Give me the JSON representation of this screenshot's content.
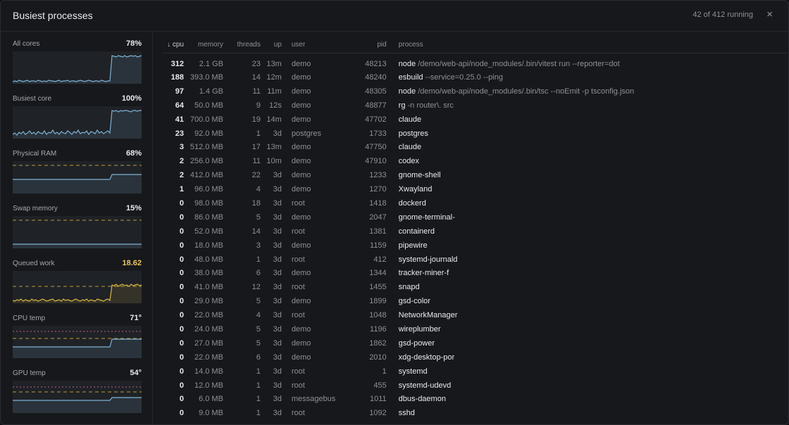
{
  "header": {
    "title": "Busiest processes",
    "count": "42 of 412 running",
    "close": "×"
  },
  "metrics": [
    {
      "label": "All cores",
      "value": "78%",
      "warn": false,
      "color": "#7fb2d6",
      "series": [
        3,
        4,
        3,
        5,
        4,
        3,
        4,
        5,
        3,
        4,
        4,
        3,
        5,
        4,
        3,
        4,
        3,
        5,
        4,
        4,
        3,
        4,
        5,
        3,
        4,
        4,
        5,
        3,
        4,
        4,
        3,
        4,
        5,
        4,
        3,
        4,
        5,
        4,
        3,
        4,
        4,
        3,
        5,
        4,
        3,
        4,
        4,
        40,
        39,
        38,
        40,
        39,
        38,
        40,
        38,
        39,
        40,
        39,
        40,
        38,
        39,
        40
      ]
    },
    {
      "label": "Busiest core",
      "value": "100%",
      "warn": false,
      "color": "#7fb2d6",
      "series": [
        6,
        8,
        5,
        9,
        7,
        10,
        6,
        8,
        11,
        7,
        9,
        6,
        10,
        8,
        7,
        11,
        6,
        9,
        8,
        12,
        7,
        9,
        6,
        10,
        8,
        7,
        11,
        9,
        6,
        10,
        8,
        12,
        7,
        9,
        8,
        11,
        6,
        10,
        9,
        7,
        12,
        8,
        10,
        7,
        9,
        11,
        8,
        40,
        39,
        40,
        38,
        40,
        39,
        40,
        40,
        39,
        38,
        40,
        40,
        39,
        40,
        40
      ]
    },
    {
      "label": "Physical RAM",
      "value": "68%",
      "warn": false,
      "color": "#7fb2d6",
      "series": [
        20,
        20,
        20,
        20,
        20,
        20,
        20,
        20,
        20,
        20,
        20,
        20,
        20,
        20,
        20,
        20,
        20,
        20,
        20,
        20,
        20,
        20,
        20,
        20,
        20,
        20,
        20,
        20,
        20,
        20,
        20,
        20,
        20,
        20,
        20,
        20,
        20,
        20,
        20,
        20,
        20,
        20,
        20,
        20,
        20,
        20,
        20,
        27,
        27,
        27,
        27,
        27,
        27,
        27,
        27,
        27,
        27,
        27,
        27,
        27,
        27,
        27
      ],
      "threshold": 40
    },
    {
      "label": "Swap memory",
      "value": "15%",
      "warn": false,
      "color": "#7fb2d6",
      "series": [
        6,
        6,
        6,
        6,
        6,
        6,
        6,
        6,
        6,
        6,
        6,
        6,
        6,
        6,
        6,
        6,
        6,
        6,
        6,
        6,
        6,
        6,
        6,
        6,
        6,
        6,
        6,
        6,
        6,
        6,
        6,
        6,
        6,
        6,
        6,
        6,
        6,
        6,
        6,
        6,
        6,
        6,
        6,
        6,
        6,
        6,
        6,
        6,
        6,
        6,
        6,
        6,
        6,
        6,
        6,
        6,
        6,
        6,
        6,
        6,
        6,
        6
      ],
      "threshold": 40
    },
    {
      "label": "Queued work",
      "value": "18.62",
      "warn": true,
      "color": "#d9b941",
      "series": [
        4,
        3,
        5,
        4,
        6,
        3,
        5,
        4,
        3,
        6,
        4,
        5,
        3,
        4,
        6,
        5,
        3,
        4,
        5,
        6,
        3,
        4,
        5,
        3,
        6,
        4,
        5,
        4,
        3,
        5,
        6,
        4,
        3,
        5,
        4,
        6,
        3,
        5,
        4,
        3,
        6,
        5,
        4,
        3,
        5,
        6,
        4,
        26,
        25,
        27,
        24,
        26,
        27,
        25,
        26,
        24,
        27,
        25,
        26,
        27,
        25,
        26
      ],
      "threshold": 24
    },
    {
      "label": "CPU temp",
      "value": "71°",
      "warn": false,
      "color": "#7fb2d6",
      "series": [
        16,
        16,
        16,
        16,
        16,
        16,
        16,
        16,
        16,
        16,
        16,
        16,
        16,
        16,
        16,
        16,
        16,
        16,
        16,
        16,
        16,
        16,
        16,
        16,
        16,
        16,
        16,
        16,
        16,
        16,
        16,
        16,
        16,
        16,
        16,
        16,
        16,
        16,
        16,
        16,
        16,
        16,
        16,
        16,
        16,
        16,
        16,
        27,
        27,
        27,
        27,
        27,
        27,
        27,
        27,
        27,
        27,
        27,
        27,
        27,
        27,
        27
      ],
      "threshold": 28,
      "threshold2": 38
    },
    {
      "label": "GPU temp",
      "value": "54°",
      "warn": false,
      "color": "#7fb2d6",
      "series": [
        18,
        18,
        18,
        18,
        18,
        18,
        18,
        18,
        18,
        18,
        18,
        18,
        18,
        18,
        18,
        18,
        18,
        18,
        18,
        18,
        18,
        18,
        18,
        18,
        18,
        18,
        18,
        18,
        18,
        18,
        18,
        18,
        18,
        18,
        18,
        18,
        18,
        18,
        18,
        18,
        18,
        18,
        18,
        18,
        18,
        18,
        18,
        22,
        22,
        22,
        22,
        22,
        22,
        22,
        22,
        22,
        22,
        22,
        22,
        22,
        22,
        22
      ],
      "threshold": 30,
      "threshold2": 37
    }
  ],
  "table": {
    "columns": {
      "cpu": "↓ cpu",
      "memory": "memory",
      "threads": "threads",
      "up": "up",
      "user": "user",
      "pid": "pid",
      "process": "process"
    },
    "rows": [
      {
        "cpu": "312",
        "memory": "2.1 GB",
        "threads": "23",
        "up": "13m",
        "user": "demo",
        "pid": "48213",
        "name": "node",
        "args": " /demo/web-api/node_modules/.bin/vitest run --reporter=dot"
      },
      {
        "cpu": "188",
        "memory": "393.0 MB",
        "threads": "14",
        "up": "12m",
        "user": "demo",
        "pid": "48240",
        "name": "esbuild",
        "args": " --service=0.25.0 --ping"
      },
      {
        "cpu": "97",
        "memory": "1.4 GB",
        "threads": "11",
        "up": "11m",
        "user": "demo",
        "pid": "48305",
        "name": "node",
        "args": " /demo/web-api/node_modules/.bin/tsc --noEmit -p tsconfig.json"
      },
      {
        "cpu": "64",
        "memory": "50.0 MB",
        "threads": "9",
        "up": "12s",
        "user": "demo",
        "pid": "48877",
        "name": "rg",
        "args": " -n router\\. src"
      },
      {
        "cpu": "41",
        "memory": "700.0 MB",
        "threads": "19",
        "up": "14m",
        "user": "demo",
        "pid": "47702",
        "name": "claude",
        "args": ""
      },
      {
        "cpu": "23",
        "memory": "92.0 MB",
        "threads": "1",
        "up": "3d",
        "user": "postgres",
        "pid": "1733",
        "name": "postgres",
        "args": ""
      },
      {
        "cpu": "3",
        "memory": "512.0 MB",
        "threads": "17",
        "up": "13m",
        "user": "demo",
        "pid": "47750",
        "name": "claude",
        "args": ""
      },
      {
        "cpu": "2",
        "memory": "256.0 MB",
        "threads": "11",
        "up": "10m",
        "user": "demo",
        "pid": "47910",
        "name": "codex",
        "args": ""
      },
      {
        "cpu": "2",
        "memory": "412.0 MB",
        "threads": "22",
        "up": "3d",
        "user": "demo",
        "pid": "1233",
        "name": "gnome-shell",
        "args": ""
      },
      {
        "cpu": "1",
        "memory": "96.0 MB",
        "threads": "4",
        "up": "3d",
        "user": "demo",
        "pid": "1270",
        "name": "Xwayland",
        "args": ""
      },
      {
        "cpu": "0",
        "memory": "98.0 MB",
        "threads": "18",
        "up": "3d",
        "user": "root",
        "pid": "1418",
        "name": "dockerd",
        "args": ""
      },
      {
        "cpu": "0",
        "memory": "86.0 MB",
        "threads": "5",
        "up": "3d",
        "user": "demo",
        "pid": "2047",
        "name": "gnome-terminal-",
        "args": ""
      },
      {
        "cpu": "0",
        "memory": "52.0 MB",
        "threads": "14",
        "up": "3d",
        "user": "root",
        "pid": "1381",
        "name": "containerd",
        "args": ""
      },
      {
        "cpu": "0",
        "memory": "18.0 MB",
        "threads": "3",
        "up": "3d",
        "user": "demo",
        "pid": "1159",
        "name": "pipewire",
        "args": ""
      },
      {
        "cpu": "0",
        "memory": "48.0 MB",
        "threads": "1",
        "up": "3d",
        "user": "root",
        "pid": "412",
        "name": "systemd-journald",
        "args": ""
      },
      {
        "cpu": "0",
        "memory": "38.0 MB",
        "threads": "6",
        "up": "3d",
        "user": "demo",
        "pid": "1344",
        "name": "tracker-miner-f",
        "args": ""
      },
      {
        "cpu": "0",
        "memory": "41.0 MB",
        "threads": "12",
        "up": "3d",
        "user": "root",
        "pid": "1455",
        "name": "snapd",
        "args": ""
      },
      {
        "cpu": "0",
        "memory": "29.0 MB",
        "threads": "5",
        "up": "3d",
        "user": "demo",
        "pid": "1899",
        "name": "gsd-color",
        "args": ""
      },
      {
        "cpu": "0",
        "memory": "22.0 MB",
        "threads": "4",
        "up": "3d",
        "user": "root",
        "pid": "1048",
        "name": "NetworkManager",
        "args": ""
      },
      {
        "cpu": "0",
        "memory": "24.0 MB",
        "threads": "5",
        "up": "3d",
        "user": "demo",
        "pid": "1196",
        "name": "wireplumber",
        "args": ""
      },
      {
        "cpu": "0",
        "memory": "27.0 MB",
        "threads": "5",
        "up": "3d",
        "user": "demo",
        "pid": "1862",
        "name": "gsd-power",
        "args": ""
      },
      {
        "cpu": "0",
        "memory": "22.0 MB",
        "threads": "6",
        "up": "3d",
        "user": "demo",
        "pid": "2010",
        "name": "xdg-desktop-por",
        "args": ""
      },
      {
        "cpu": "0",
        "memory": "14.0 MB",
        "threads": "1",
        "up": "3d",
        "user": "root",
        "pid": "1",
        "name": "systemd",
        "args": ""
      },
      {
        "cpu": "0",
        "memory": "12.0 MB",
        "threads": "1",
        "up": "3d",
        "user": "root",
        "pid": "455",
        "name": "systemd-udevd",
        "args": ""
      },
      {
        "cpu": "0",
        "memory": "6.0 MB",
        "threads": "1",
        "up": "3d",
        "user": "messagebus",
        "pid": "1011",
        "name": "dbus-daemon",
        "args": ""
      },
      {
        "cpu": "0",
        "memory": "9.0 MB",
        "threads": "1",
        "up": "3d",
        "user": "root",
        "pid": "1092",
        "name": "sshd",
        "args": ""
      }
    ]
  }
}
